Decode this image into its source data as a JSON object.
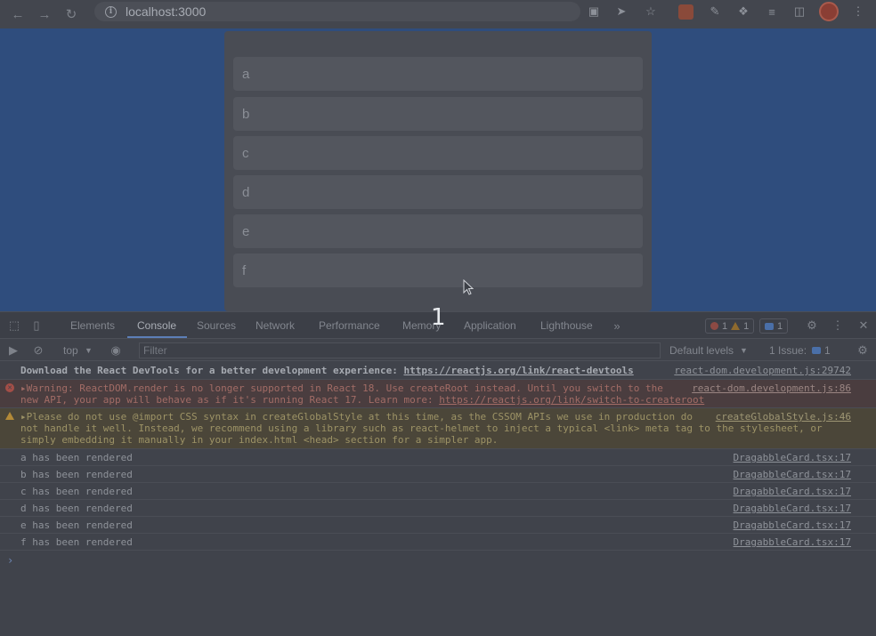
{
  "browser": {
    "url": "localhost:3000",
    "back_icon": "arrow-left-icon",
    "forward_icon": "arrow-right-icon",
    "reload_icon": "reload-icon"
  },
  "page": {
    "cards": [
      "a",
      "b",
      "c",
      "d",
      "e",
      "f"
    ],
    "overlay_number": "1"
  },
  "devtools": {
    "tabs": [
      "Elements",
      "Console",
      "Sources",
      "Network",
      "Performance",
      "Memory",
      "Application",
      "Lighthouse"
    ],
    "active_tab": "Console",
    "counts": {
      "errors": "1",
      "warnings": "1",
      "messages": "1"
    },
    "context": "top",
    "filter_placeholder": "Filter",
    "levels": "Default levels",
    "issues_label": "1 Issue:",
    "issues_count": "1",
    "logs": {
      "devtools_msg": "Download the React DevTools for a better development experience: ",
      "devtools_link": "https://reactjs.org/link/react-devtools",
      "devtools_src": "react-dom.development.js:29742",
      "warning1_line1": "Warning: ReactDOM.render is no longer supported in React 18. Use createRoot instead. Until you switch to the",
      "warning1_line2": "new API, your app will behave as if it's running React 17. Learn more: ",
      "warning1_link": "https://reactjs.org/link/switch-to-createroot",
      "warning1_src": "react-dom.development.js:86",
      "warning2_line1": "Please do not use @import CSS syntax in createGlobalStyle at this time, as the CSSOM APIs we use in production do",
      "warning2_line2": "not handle it well. Instead, we recommend using a library such as react-helmet to inject a typical <link> meta tag to the stylesheet, or",
      "warning2_line3": "simply embedding it manually in your index.html <head> section for a simpler app.",
      "warning2_src": "createGlobalStyle.js:46",
      "rendered": [
        "a has been rendered",
        "b has been rendered",
        "c has been rendered",
        "d has been rendered",
        "e has been rendered",
        "f has been rendered"
      ],
      "rendered_src": "DragabbleCard.tsx:17"
    }
  }
}
